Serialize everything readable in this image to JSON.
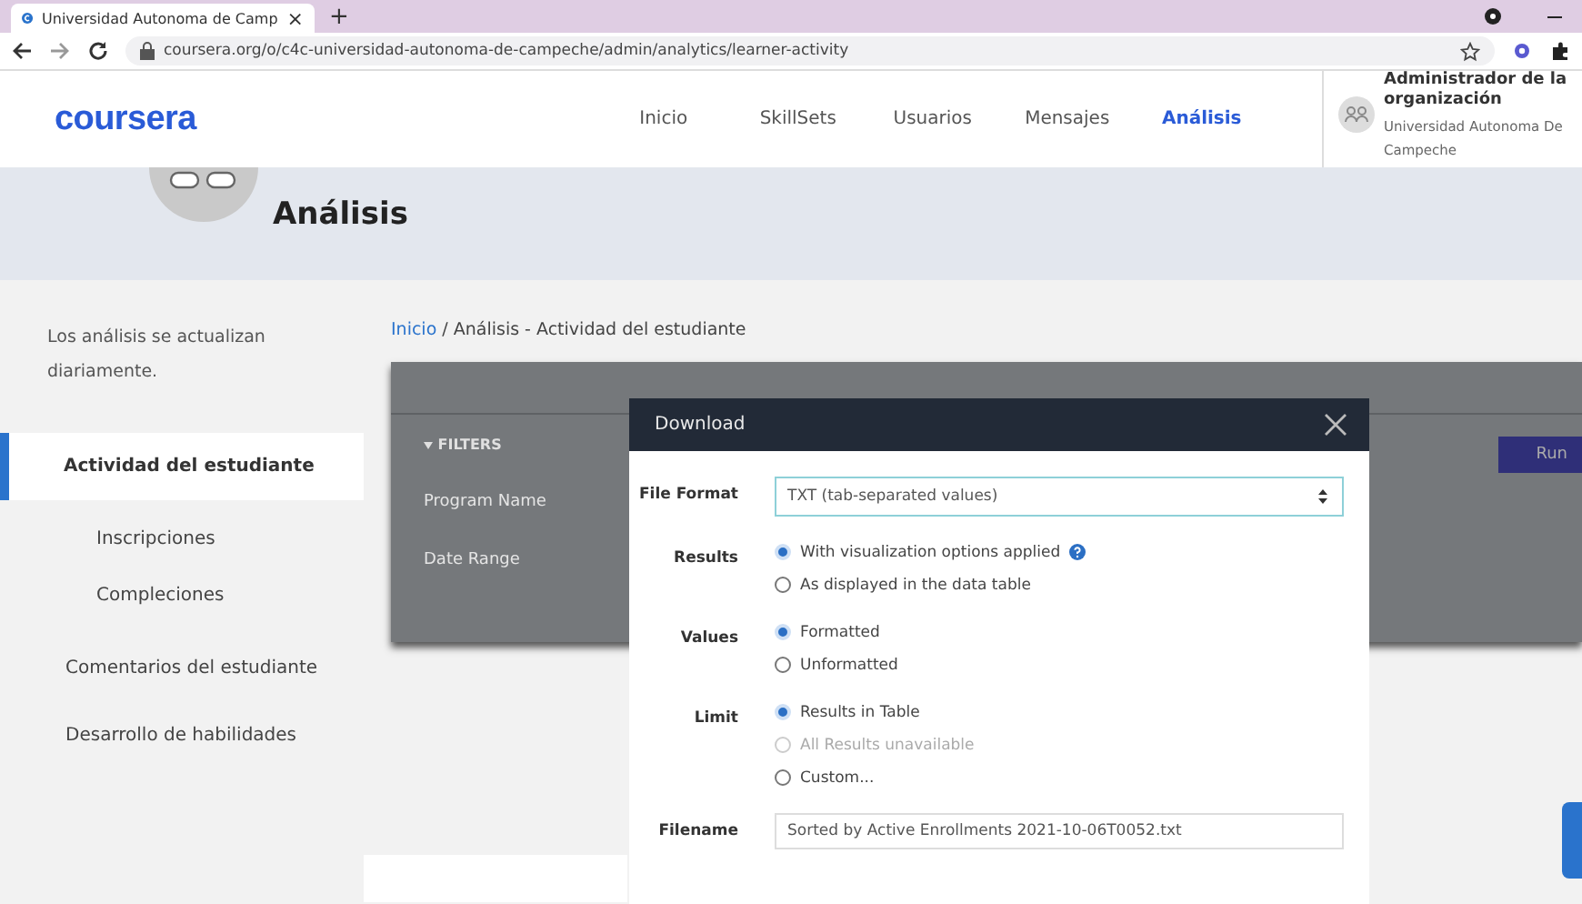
{
  "browser": {
    "tab_title": "Universidad Autonoma de Camp",
    "tab_close": "×",
    "new_tab": "+",
    "url": "coursera.org/o/c4c-universidad-autonoma-de-campeche/admin/analytics/learner-activity"
  },
  "header": {
    "logo": "coursera",
    "nav": [
      {
        "label": "Inicio",
        "selected": false
      },
      {
        "label": "SkillSets",
        "selected": false
      },
      {
        "label": "Usuarios",
        "selected": false
      },
      {
        "label": "Mensajes",
        "selected": false
      },
      {
        "label": "Análisis",
        "selected": true
      }
    ],
    "profile": {
      "role": "Administrador de la organización",
      "org": "Universidad Autonoma De Campeche"
    }
  },
  "banner": {
    "title": "Análisis"
  },
  "sidebar": {
    "note": "Los análisis se actualizan diariamente.",
    "items": [
      {
        "label": "Actividad del estudiante",
        "selected": true,
        "children": [
          {
            "label": "Inscripciones",
            "selected": false
          },
          {
            "label": "Compleciones",
            "selected": false
          }
        ]
      },
      {
        "label": "Comentarios del estudiante",
        "selected": false
      },
      {
        "label": "Desarrollo de habilidades",
        "selected": false
      }
    ]
  },
  "breadcrumb": {
    "link": "Inicio",
    "rest": "/ Análisis - Actividad del estudiante"
  },
  "filters": {
    "title": "FILTERS",
    "fields": [
      "Program Name",
      "Date Range"
    ],
    "run": "Run"
  },
  "modal": {
    "title": "Download",
    "rows": [
      {
        "kind": "select",
        "label": "File Format",
        "value": "TXT (tab-separated values)"
      },
      {
        "kind": "radio",
        "label": "Results",
        "options": [
          {
            "label": "With visualization options applied",
            "selected": true,
            "disabled": false,
            "help": true
          },
          {
            "label": "As displayed in the data table",
            "selected": false,
            "disabled": false,
            "help": false
          }
        ]
      },
      {
        "kind": "radio",
        "label": "Values",
        "options": [
          {
            "label": "Formatted",
            "selected": true,
            "disabled": false,
            "help": false
          },
          {
            "label": "Unformatted",
            "selected": false,
            "disabled": false,
            "help": false
          }
        ]
      },
      {
        "kind": "radio",
        "label": "Limit",
        "options": [
          {
            "label": "Results in Table",
            "selected": true,
            "disabled": false,
            "help": false
          },
          {
            "label": "All Results unavailable",
            "selected": false,
            "disabled": true,
            "help": false
          },
          {
            "label": "Custom...",
            "selected": false,
            "disabled": false,
            "help": false
          }
        ]
      },
      {
        "kind": "text",
        "label": "Filename",
        "value": "Sorted by Active Enrollments 2021-10-06T0052.txt"
      }
    ]
  }
}
